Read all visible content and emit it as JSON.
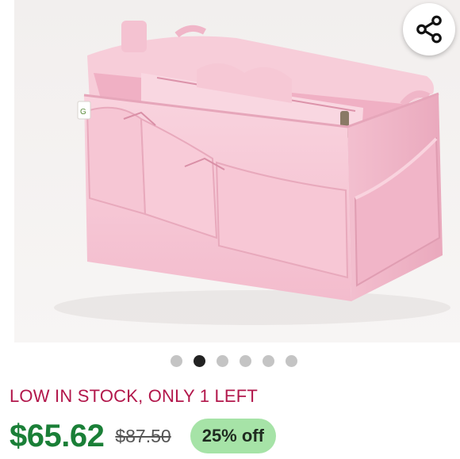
{
  "product": {
    "image_alt": "Pink felt purse organizer insert with pockets",
    "stock_notice": "LOW IN STOCK, ONLY 1 LEFT",
    "price": "$65.62",
    "original_price": "$87.50",
    "discount_badge": "25% off"
  },
  "gallery": {
    "total_images": 6,
    "active_index": 1
  },
  "icons": {
    "share": "share-icon"
  },
  "colors": {
    "stock_notice": "#b2174b",
    "price": "#1a7f37",
    "badge_bg": "#a6e3a7",
    "active_dot": "#222222",
    "inactive_dot": "#c4c4c4",
    "product_pink": "#f5c3d2"
  }
}
